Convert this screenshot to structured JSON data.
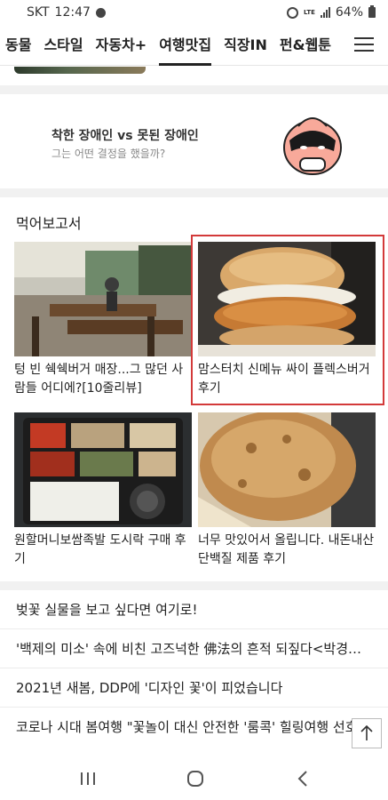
{
  "status_bar": {
    "carrier": "SKT",
    "time": "12:47",
    "network": "LTE",
    "battery": "64%"
  },
  "tabs": [
    {
      "label": "동물"
    },
    {
      "label": "스타일"
    },
    {
      "label": "자동차+"
    },
    {
      "label": "여행맛집"
    },
    {
      "label": "직장IN"
    },
    {
      "label": "펀&웹툰"
    }
  ],
  "active_tab": "여행맛집",
  "promo": {
    "title": "착한 장애인 vs 못된 장애인",
    "subtitle": "그는 어떤 결정을 했을까?"
  },
  "section": {
    "title": "먹어보고서",
    "cards": [
      {
        "caption": "텅 빈 쉑쉑버거 매장...그 많던 사람들 어디에?[10줄리뷰]",
        "image": "restaurant-interior"
      },
      {
        "caption": "맘스터치 신메뉴 싸이 플렉스버거 후기",
        "image": "chicken-burger"
      },
      {
        "caption": "원할머니보쌈족발 도시락 구매 후기",
        "image": "lunchbox"
      },
      {
        "caption": "너무 맛있어서 올립니다. 내돈내산 단백질 제품 후기",
        "image": "protein-cookie"
      }
    ]
  },
  "articles": [
    {
      "title": "벚꽃 실물을 보고 싶다면 여기로!"
    },
    {
      "title": "'백제의 미소' 속에 비친 고즈넉한 佛法의 흔적 되짚다<박경일…"
    },
    {
      "title": "2021년 새봄, DDP에 '디자인 꽃'이 피었습니다"
    },
    {
      "title": "코로나 시대 봄여행 \"꽃놀이 대신 안전한 '룸콕' 힐링여행 선호\""
    }
  ],
  "colors": {
    "highlight_border": "#d33a3a",
    "divider": "#f1f1f1"
  }
}
